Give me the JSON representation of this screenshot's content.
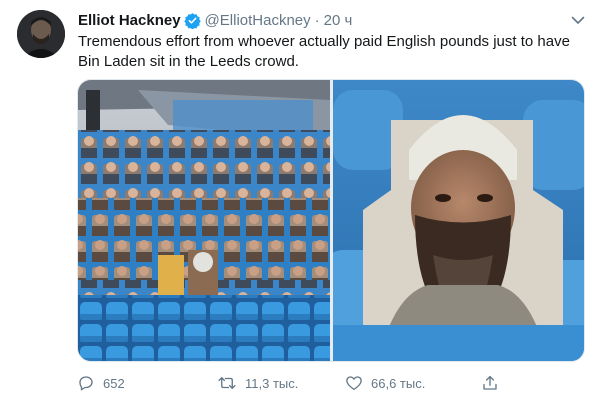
{
  "tweet": {
    "display_name": "Elliot Hackney",
    "handle": "@ElliotHackney",
    "separator": "·",
    "time": "20 ч",
    "text_line1": "Tremendous effort from whoever actually paid English pounds just to have",
    "text_line2": "Bin Laden sit in the Leeds crowd.",
    "verified": true,
    "verified_color": "#1da1f2",
    "media_count": 2
  },
  "actions": {
    "reply_count": "652",
    "retweet_count": "11,3 тыс.",
    "like_count": "66,6 тыс.",
    "icons": [
      "reply-icon",
      "retweet-icon",
      "like-icon",
      "share-icon"
    ]
  },
  "colors": {
    "text": "#14171a",
    "secondary": "#657786",
    "accent": "#1da1f2",
    "seat_blue": "#2b8fd6"
  }
}
